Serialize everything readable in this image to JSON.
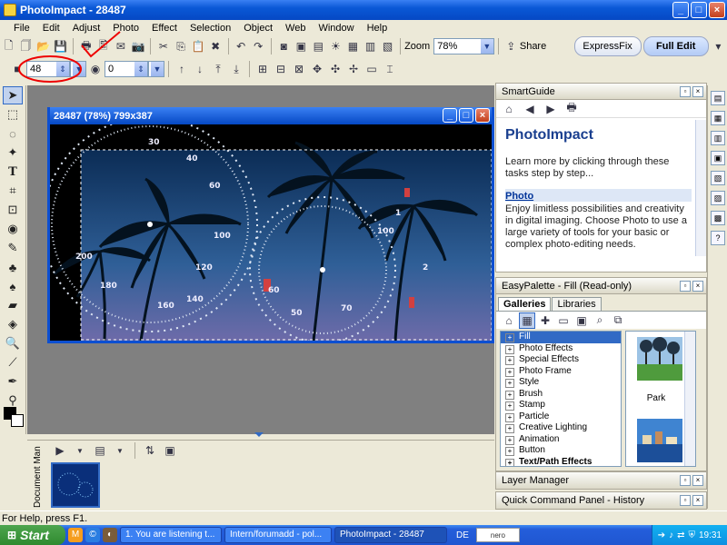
{
  "window": {
    "title": "PhotoImpact - 28487"
  },
  "menu": [
    "File",
    "Edit",
    "Adjust",
    "Photo",
    "Effect",
    "Selection",
    "Object",
    "Web",
    "Window",
    "Help"
  ],
  "toolbar": {
    "zoom_label": "Zoom",
    "zoom_value": "78%",
    "share_label": "Share",
    "expressfix_label": "ExpressFix",
    "fulledit_label": "Full Edit"
  },
  "attribute_bar": {
    "size_value": "48",
    "second_value": "0"
  },
  "document": {
    "title": "28487 (78%) 799x387"
  },
  "document_manager": {
    "label": "Document Man"
  },
  "smartguide": {
    "header": "SmartGuide",
    "title": "PhotoImpact",
    "intro": "Learn more by clicking through these tasks step by step...",
    "link": "Photo",
    "body": "Enjoy limitless possibilities and creativity in digital imaging. Choose Photo to use a large variety of tools for your basic or complex photo-editing needs."
  },
  "easypalette": {
    "header": "EasyPalette - Fill (Read-only)",
    "tabs": [
      "Galleries",
      "Libraries"
    ],
    "items": [
      {
        "label": "Fill",
        "selected": true
      },
      {
        "label": "Photo Effects"
      },
      {
        "label": "Special Effects"
      },
      {
        "label": "Photo Frame"
      },
      {
        "label": "Style"
      },
      {
        "label": "Brush"
      },
      {
        "label": "Stamp"
      },
      {
        "label": "Particle"
      },
      {
        "label": "Creative Lighting"
      },
      {
        "label": "Animation"
      },
      {
        "label": "Button"
      },
      {
        "label": "Text/Path Effects",
        "bold": true
      }
    ],
    "preview_label": "Park"
  },
  "layer_manager": {
    "header": "Layer Manager"
  },
  "quick_command": {
    "header": "Quick Command Panel - History"
  },
  "status": {
    "text": "For Help, press F1."
  },
  "taskbar": {
    "start": "Start",
    "tasks": [
      "1. You are listening t...",
      "Intern/forumadd - pol...",
      "PhotoImpact - 28487"
    ],
    "lang": "DE",
    "search_label": "nero SEARCH",
    "time": "19:31"
  }
}
